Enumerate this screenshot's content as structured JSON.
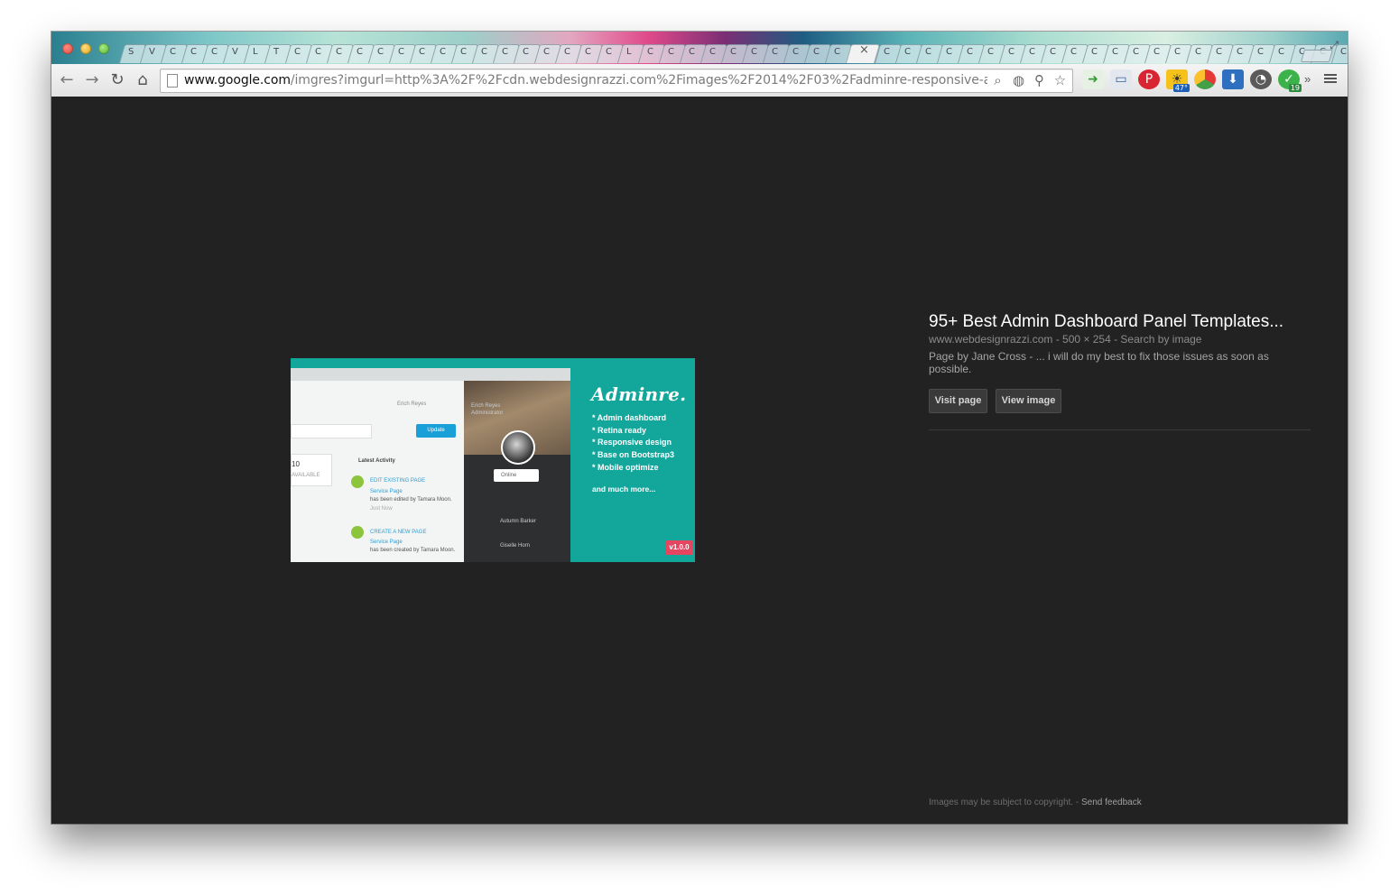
{
  "tabs": {
    "glyphs": [
      "S",
      "V",
      "C",
      "C",
      "C",
      "V",
      "L",
      "T",
      "C",
      "C",
      "C",
      "C",
      "C",
      "C",
      "C",
      "C",
      "C",
      "C",
      "C",
      "C",
      "C",
      "C",
      "C",
      "C",
      "L",
      "C",
      "C",
      "C",
      "C",
      "C",
      "C",
      "C",
      "C",
      "C",
      "C",
      "×",
      "C",
      "C",
      "C",
      "C",
      "C",
      "C",
      "C",
      "C",
      "C",
      "C",
      "C",
      "C",
      "C",
      "C",
      "C",
      "C",
      "C",
      "C",
      "C",
      "C",
      "C",
      "C",
      "C",
      "C",
      "C",
      "C",
      "C",
      "S"
    ],
    "active_index": 35
  },
  "toolbar": {
    "url_host": "www.google.com",
    "url_path": "/imgres?imgurl=http%3A%2F%2Fcdn.webdesignrazzi.com%2Fimages%2F2014%2F03%2Fadminre-responsive-ad...",
    "extension_badges": {
      "weather": "47°",
      "evernote": "19"
    }
  },
  "preview": {
    "brand": "Adminre.",
    "features": [
      "* Admin dashboard",
      "* Retina ready",
      "* Responsive design",
      "* Base on Bootstrap3",
      "* Mobile optimize"
    ],
    "more": "and much more...",
    "version": "v1.0.0",
    "user_name": "Erich Reyes",
    "user_role": "Administrator",
    "update_btn": "Update",
    "latest_activity": "Latest Activity",
    "edit_page": "EDIT EXISTING PAGE",
    "create_page": "CREATE A NEW PAGE",
    "service_page": "Service Page",
    "edited_by": "has been edited by Tamara Moon.",
    "created_by": "has been created by Tamara Moon.",
    "just_now": "Just Now",
    "online": "Online",
    "contact1": "Autumn Barker",
    "contact2": "Giselle Horn",
    "available": "AVAILABLE",
    "ten": "10"
  },
  "info": {
    "title": "95+ Best Admin Dashboard Panel Templates...",
    "meta": "www.webdesignrazzi.com - 500 × 254 - Search by image",
    "description": "Page by Jane Cross - ... i will do my best to fix those issues as soon as possible.",
    "visit_page": "Visit page",
    "view_image": "View image"
  },
  "footer": {
    "copyright": "Images may be subject to copyright.",
    "separator": " - ",
    "feedback": "Send feedback"
  },
  "colors": {
    "page_bg": "#222222",
    "teal": "#13a79c",
    "version_badge": "#e64561"
  }
}
